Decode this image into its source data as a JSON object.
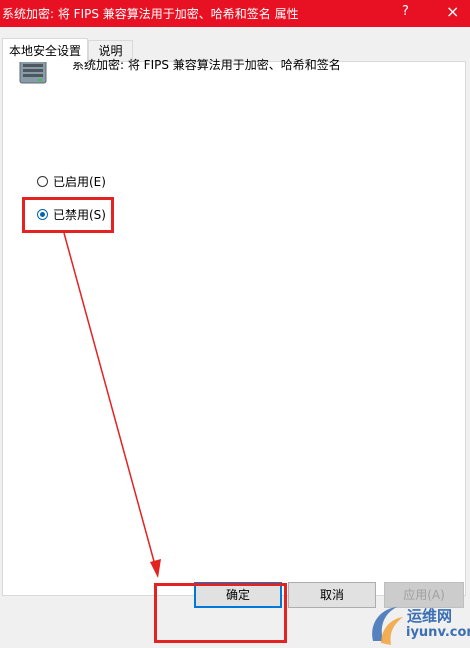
{
  "window": {
    "title": "系统加密: 将 FIPS 兼容算法用于加密、哈希和签名 属性",
    "help_glyph": "?",
    "close_glyph": "×"
  },
  "tabs": [
    {
      "label": "本地安全设置",
      "active": true
    },
    {
      "label": "说明",
      "active": false
    }
  ],
  "policy": {
    "icon": "server-icon",
    "title": "系统加密: 将 FIPS 兼容算法用于加密、哈希和签名"
  },
  "options": [
    {
      "label": "已启用(E)",
      "checked": false
    },
    {
      "label": "已禁用(S)",
      "checked": true
    }
  ],
  "buttons": {
    "ok": "确定",
    "cancel": "取消",
    "apply": "应用(A)"
  },
  "watermark": {
    "cn": "运维网",
    "url": "iyunv.com"
  },
  "colors": {
    "titlebar": "#e81123",
    "highlight": "#e32222",
    "accent": "#0078d7"
  }
}
